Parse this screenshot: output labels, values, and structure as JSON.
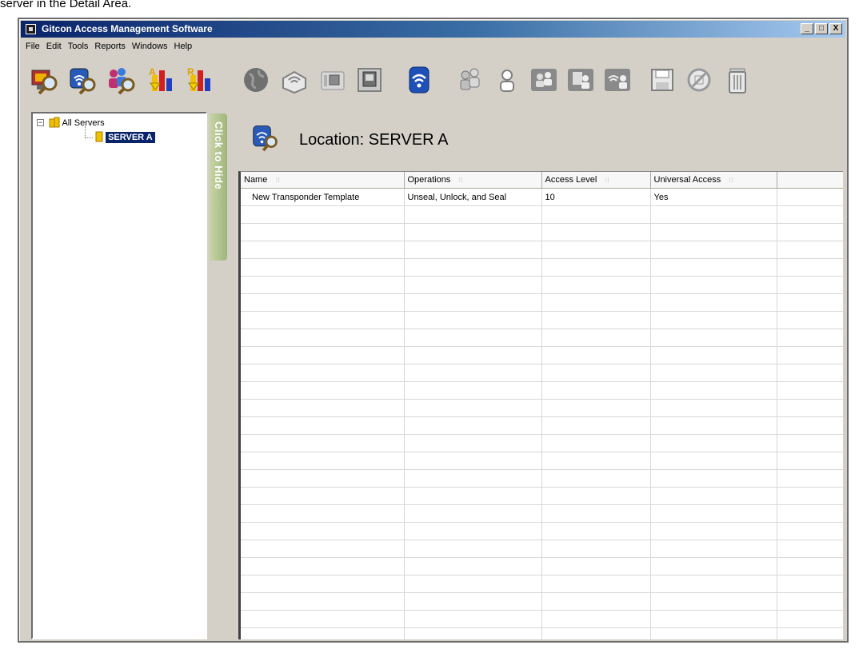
{
  "caption": "server in the Detail Area.",
  "window": {
    "title": "Gitcon Access Management Software",
    "buttons": [
      "_",
      "□",
      "X"
    ]
  },
  "menu": [
    "File",
    "Edit",
    "Tools",
    "Reports",
    "Windows",
    "Help"
  ],
  "toolbar": {
    "icons": [
      "search-computer-icon",
      "search-transponder-icon",
      "search-users-icon",
      "report-a-icon",
      "report-r-icon",
      "globe-icon",
      "gateway-icon",
      "reader-icon",
      "panel-icon",
      "transponder-icon",
      "users-group-icon",
      "user-icon",
      "group-doors-icon",
      "group-door-icon",
      "group-transponder-icon",
      "save-icon",
      "disable-icon",
      "trash-icon"
    ]
  },
  "tree": {
    "root": "All Servers",
    "expander": "−",
    "child": "SERVER A"
  },
  "hide_tab": "Click to Hide",
  "location": {
    "title": "Location: SERVER A"
  },
  "table": {
    "columns": [
      "Name",
      "Operations",
      "Access Level",
      "Universal Access",
      ""
    ],
    "rows": [
      [
        "New Transponder Template",
        "Unseal, Unlock, and Seal",
        "10",
        "Yes",
        ""
      ]
    ]
  },
  "colors": {
    "title_start": "#0a246a",
    "selection": "#0a246a",
    "hide_tab": "#9fb57a"
  }
}
